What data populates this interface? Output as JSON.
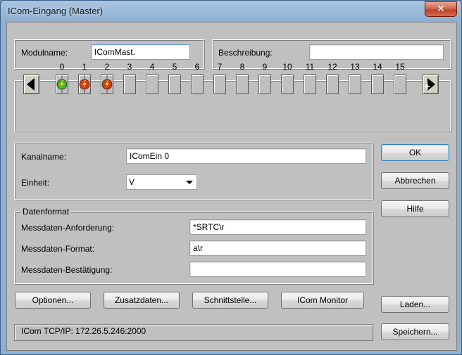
{
  "window": {
    "title": "ICom-Eingang (Master)",
    "close_glyph": "✕"
  },
  "modul": {
    "label": "Modulname:",
    "value": "IComMast."
  },
  "beschreibung": {
    "label": "Beschreibung:",
    "value": ""
  },
  "channels": {
    "numbers": [
      "0",
      "1",
      "2",
      "3",
      "4",
      "5",
      "6",
      "7",
      "8",
      "9",
      "10",
      "11",
      "12",
      "13",
      "14",
      "15"
    ],
    "states": [
      "green",
      "red",
      "red",
      "empty",
      "empty",
      "empty",
      "empty",
      "empty",
      "empty",
      "empty",
      "empty",
      "empty",
      "empty",
      "empty",
      "empty",
      "empty"
    ],
    "prev_icon": "arrow-left-icon",
    "next_icon": "arrow-right-plus-icon"
  },
  "kanal": {
    "label": "Kanalname:",
    "value": "IComEin 0"
  },
  "einheit": {
    "label": "Einheit:",
    "value": "V"
  },
  "datenformat": {
    "legend": "Datenformat",
    "anforderung_label": "Messdaten-Anforderung:",
    "anforderung_value": "*SRTC\\r",
    "format_label": "Messdaten-Format:",
    "format_value": "a\\r",
    "bestaetigung_label": "Messdaten-Bestätigung:",
    "bestaetigung_value": ""
  },
  "buttons": {
    "ok": "OK",
    "abbrechen": "Abbrechen",
    "hilfe": "Hilfe",
    "optionen": "Optionen...",
    "zusatzdaten": "Zusatzdaten...",
    "schnittstelle": "Schnittstelle...",
    "icom_monitor": "ICom Monitor",
    "laden": "Laden...",
    "speichern": "Speichern..."
  },
  "status": {
    "text": "ICom TCP/IP: 172.26.5.246:2000"
  },
  "colors": {
    "led_green": "#4caf2a",
    "led_red": "#d23a1a",
    "bolt": "#f7d31d"
  }
}
